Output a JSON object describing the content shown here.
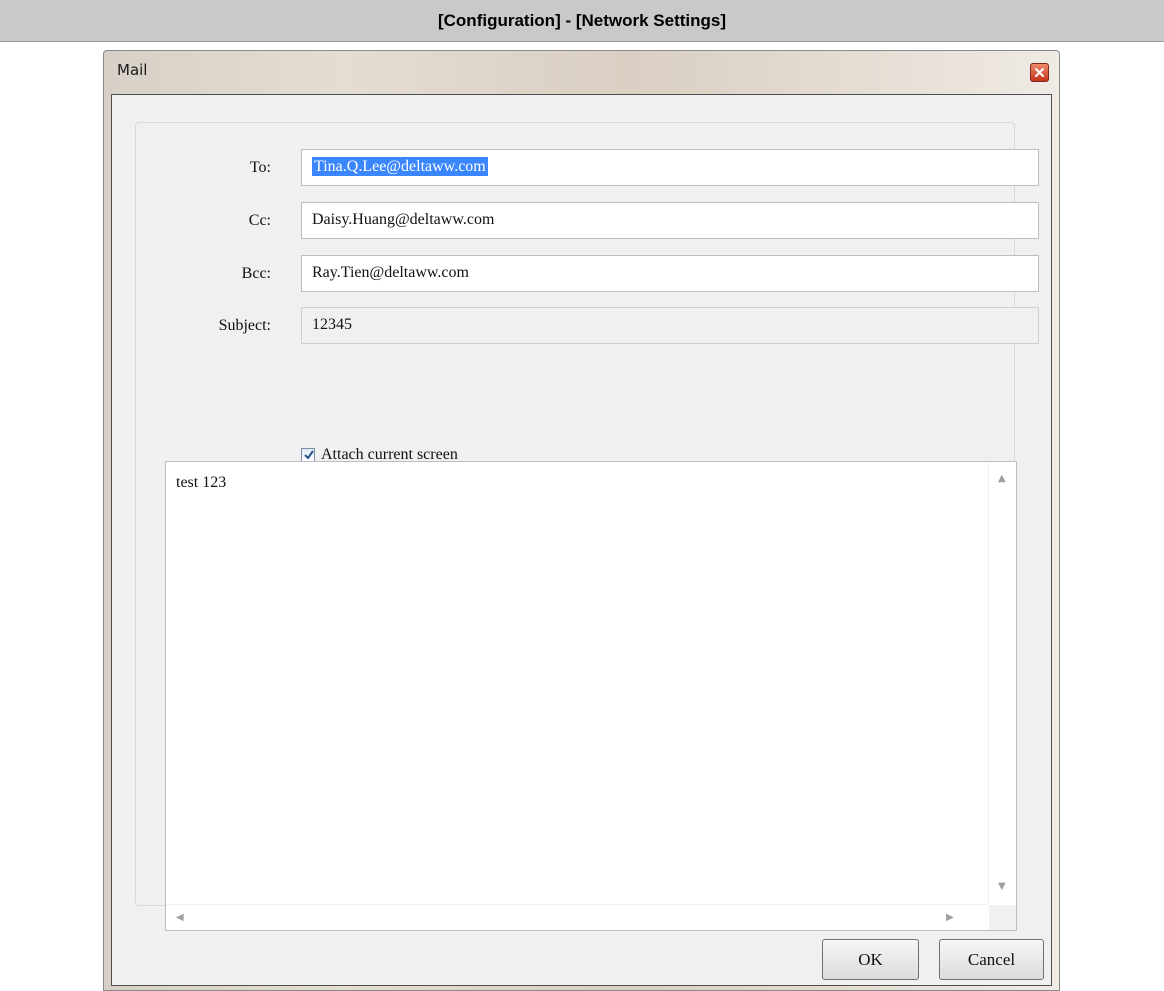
{
  "page_header": {
    "title": "[Configuration] - [Network Settings]"
  },
  "window": {
    "title": "Mail"
  },
  "form": {
    "to_label": "To:",
    "to_value": "Tina.Q.Lee@deltaww.com",
    "cc_label": "Cc:",
    "cc_value": "Daisy.Huang@deltaww.com",
    "bcc_label": "Bcc:",
    "bcc_value": "Ray.Tien@deltaww.com",
    "subject_label": "Subject:",
    "subject_value": "12345",
    "attach_label": "Attach current screen",
    "attach_checked": true,
    "body_text": "test 123"
  },
  "buttons": {
    "ok": "OK",
    "cancel": "Cancel"
  },
  "icons": {
    "close": "close-icon",
    "check": "check-icon"
  },
  "colors": {
    "selection": "#3a86ff",
    "close_button": "#d24b2a"
  }
}
